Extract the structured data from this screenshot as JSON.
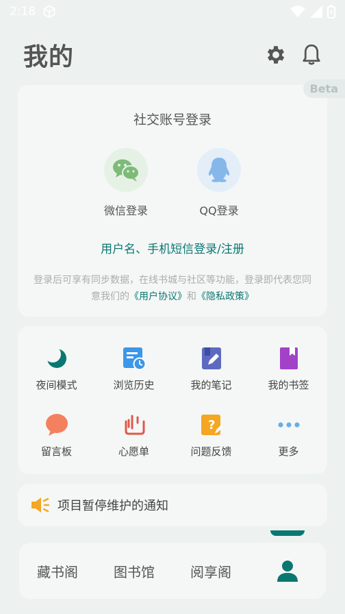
{
  "status_bar": {
    "time": "2:18"
  },
  "header": {
    "title": "我的"
  },
  "login": {
    "beta": "Beta",
    "title": "社交账号登录",
    "wechat_label": "微信登录",
    "qq_label": "QQ登录",
    "alt_login": "用户名、手机短信登录/注册",
    "terms_prefix": "登录后可享有同步数据，在线书城与社区等功能，登录即代表您同意我们的",
    "terms_user_agreement": "《用户协议》",
    "terms_and": "和",
    "terms_privacy": "《隐私政策》"
  },
  "grid": {
    "items": [
      {
        "label": "夜间模式",
        "icon": "moon-icon"
      },
      {
        "label": "浏览历史",
        "icon": "history-icon"
      },
      {
        "label": "我的笔记",
        "icon": "notes-icon"
      },
      {
        "label": "我的书签",
        "icon": "bookmark-icon"
      },
      {
        "label": "留言板",
        "icon": "message-board-icon"
      },
      {
        "label": "心愿单",
        "icon": "wishlist-icon"
      },
      {
        "label": "问题反馈",
        "icon": "feedback-icon"
      },
      {
        "label": "更多",
        "icon": "more-icon"
      }
    ]
  },
  "notice": {
    "text": "项目暂停维护的通知"
  },
  "bottom_nav": {
    "items": [
      {
        "label": "藏书阁"
      },
      {
        "label": "图书馆"
      },
      {
        "label": "阅享阁"
      }
    ],
    "active_icon": "profile-icon"
  },
  "colors": {
    "accent": "#0b7771",
    "background": "#edf2f1",
    "card": "#f4f7f6"
  }
}
